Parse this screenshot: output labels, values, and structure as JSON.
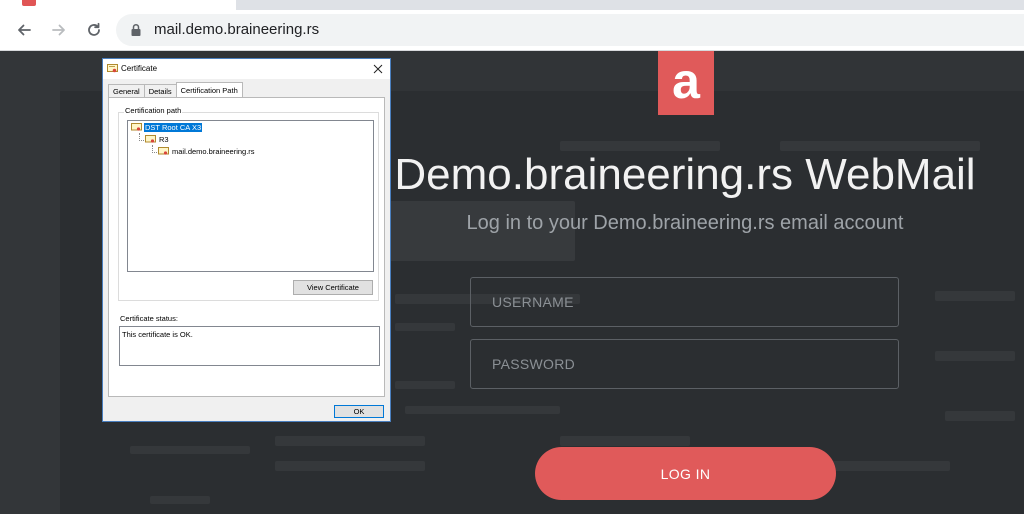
{
  "browser": {
    "url": "mail.demo.braineering.rs",
    "nav_icons": [
      "back-arrow-icon",
      "forward-arrow-icon",
      "reload-icon",
      "lock-icon"
    ]
  },
  "login": {
    "logo_letter": "a",
    "title": "Demo.braineering.rs WebMail",
    "subtitle": "Log in to your Demo.braineering.rs email account",
    "username_placeholder": "USERNAME",
    "password_placeholder": "PASSWORD",
    "login_label": "LOG IN"
  },
  "certificate_dialog": {
    "title": "Certificate",
    "tabs": [
      "General",
      "Details",
      "Certification Path"
    ],
    "active_tab": "Certification Path",
    "path_group_label": "Certification path",
    "path": [
      {
        "name": "DST Root CA X3",
        "selected": true
      },
      {
        "name": "R3",
        "selected": false
      },
      {
        "name": "mail.demo.braineering.rs",
        "selected": false
      }
    ],
    "view_certificate_label": "View Certificate",
    "status_label": "Certificate status:",
    "status_text": "This certificate is OK.",
    "ok_label": "OK"
  },
  "colors": {
    "accent": "#e05a5a",
    "page_background": "#2b2e31",
    "selection": "#0078d7"
  }
}
